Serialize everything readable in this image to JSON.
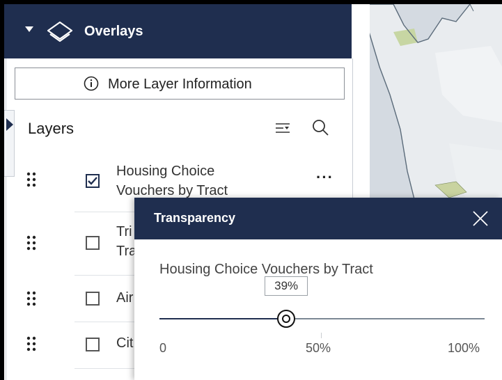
{
  "overlays": {
    "title": "Overlays",
    "icons": [
      "caret-down-icon",
      "layers-stack-icon"
    ]
  },
  "more_layer_info": {
    "label": "More Layer Information",
    "icon": "info-icon"
  },
  "layers": {
    "title": "Layers",
    "toolbar_icons": [
      "filter-icon",
      "search-icon"
    ],
    "items": [
      {
        "line1": "Housing Choice",
        "line2": "Vouchers by Tract",
        "checked": true
      },
      {
        "line1": "Tri",
        "line2": "Tra",
        "checked": false
      },
      {
        "line1": "Air",
        "line2": "",
        "checked": false
      },
      {
        "line1": "Cit",
        "line2": "",
        "checked": false
      }
    ],
    "more_label": "···"
  },
  "transparency": {
    "title": "Transparency",
    "layer_name": "Housing Choice Vouchers by Tract",
    "value_label": "39%",
    "value": 39,
    "ticks": [
      "0",
      "50%",
      "100%"
    ]
  },
  "colors": {
    "header": "#1f2e4f",
    "map": "#d2d9e0"
  }
}
